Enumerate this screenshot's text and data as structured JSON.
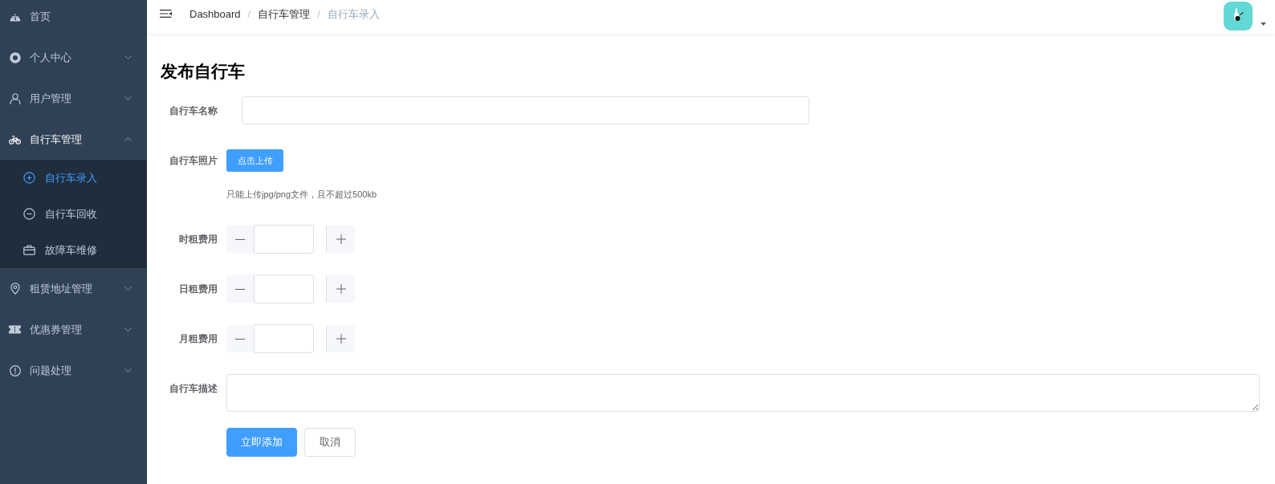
{
  "sidebar": {
    "items": [
      {
        "kind": "item",
        "label": "首页",
        "selected": false
      },
      {
        "kind": "submenu",
        "label": "个人中心",
        "selected": false,
        "expanded": false
      },
      {
        "kind": "submenu",
        "label": "用户管理",
        "selected": false,
        "expanded": false
      },
      {
        "kind": "submenu",
        "label": "自行车管理",
        "selected": false,
        "expanded": true,
        "children": [
          {
            "label": "自行车录入",
            "selected": true
          },
          {
            "label": "自行车回收",
            "selected": false
          },
          {
            "label": "故障车维修",
            "selected": false
          }
        ]
      },
      {
        "kind": "submenu",
        "label": "租赁地址管理",
        "selected": false,
        "expanded": false
      },
      {
        "kind": "submenu",
        "label": "优惠券管理",
        "selected": false,
        "expanded": false
      },
      {
        "kind": "submenu",
        "label": "问题处理",
        "selected": false,
        "expanded": false
      }
    ]
  },
  "top_bar": {
    "breadcrumb": [
      {
        "label": "Dashboard",
        "current": false
      },
      {
        "separator": "/",
        "label": "自行车管理",
        "current": false
      },
      {
        "separator": "/",
        "label": "自行车录入",
        "current": true
      }
    ]
  },
  "page": {
    "title": "发布自行车"
  },
  "form": {
    "fields": [
      {
        "kind": "text",
        "label": "自行车名称"
      },
      {
        "kind": "upload",
        "label": "自行车照片",
        "button": "点击上传",
        "hint": "只能上传jpg/png文件，且不超过500kb"
      },
      {
        "kind": "number",
        "label": "时租费用"
      },
      {
        "kind": "number",
        "label": "日租费用"
      },
      {
        "kind": "number",
        "label": "月租费用"
      },
      {
        "kind": "textarea",
        "label": "自行车描述"
      }
    ],
    "buttons": [
      {
        "kind": "primary",
        "label": "立即添加"
      },
      {
        "kind": "default",
        "label": "取消"
      }
    ]
  }
}
